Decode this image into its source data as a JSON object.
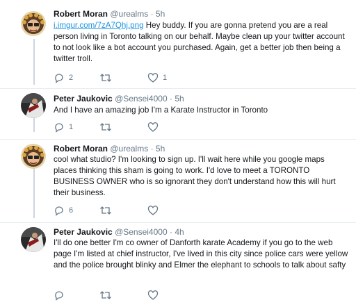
{
  "tweets": [
    {
      "name": "Robert Moran",
      "handle": "@urealms",
      "sep": "·",
      "time": "5h",
      "link": "i.imgur.com/7zA7Qhj.png",
      "text": " Hey buddy. If you are gonna pretend you are a real person living in Toronto talking on our behalf. Maybe clean up your twitter account to not look like a bot account you purchased. Again, get a better job then being a twitter troll.",
      "reply_count": "2",
      "retweet_count": "",
      "like_count": "1"
    },
    {
      "name": "Peter Jaukovic",
      "handle": "@Sensei4000",
      "sep": "·",
      "time": "5h",
      "text": "And I have an amazing job I'm a Karate Instructor in Toronto",
      "reply_count": "1",
      "retweet_count": "",
      "like_count": ""
    },
    {
      "name": "Robert Moran",
      "handle": "@urealms",
      "sep": "·",
      "time": "5h",
      "text": "cool what studio? I'm looking to sign up. I'll wait here while you google maps places thinking this sham is going to work. I'd love to meet a TORONTO BUSINESS OWNER who is so ignorant they don't understand how this will hurt their business.",
      "reply_count": "6",
      "retweet_count": "",
      "like_count": ""
    },
    {
      "name": "Peter Jaukovic",
      "handle": "@Sensei4000",
      "sep": "·",
      "time": "4h",
      "text": "I'll do one better I'm co owner of Danforth karate Academy if you go to the web page I'm listed at chief instructor, I've  lived in this city since police cars were yellow and the police brought blinky and Elmer the elephant to schools to talk about safty",
      "reply_count": "",
      "retweet_count": "",
      "like_count": ""
    }
  ],
  "icons": {
    "reply": "reply-icon",
    "retweet": "retweet-icon",
    "like": "heart-icon"
  },
  "colors": {
    "muted": "#657786",
    "link": "#1b95e0",
    "divider": "#e6ecf0",
    "thread": "#ccd6dd"
  }
}
